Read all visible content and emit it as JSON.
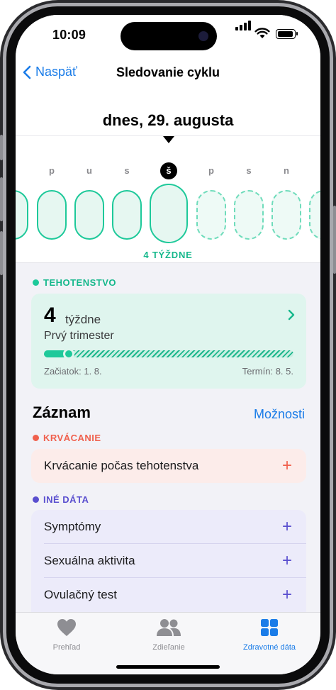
{
  "status_bar": {
    "time": "10:09"
  },
  "nav": {
    "back_label": "Naspäť",
    "title": "Sledovanie cyklu"
  },
  "calendar": {
    "date_title": "dnes, 29. augusta",
    "day_letters": [
      "p",
      "u",
      "s",
      "š",
      "p",
      "s",
      "n"
    ],
    "today_index": 3,
    "weeks_label": "4 TÝŽDNE"
  },
  "pregnancy": {
    "section_label": "TEHOTENSTVO",
    "weeks_number": "4",
    "weeks_unit": "týždne",
    "trimester": "Prvý trimester",
    "progress_fraction": 0.1,
    "start": "Začiatok: 1. 8.",
    "due": "Termín: 8. 5."
  },
  "log": {
    "title": "Záznam",
    "options_label": "Možnosti",
    "bleeding": {
      "section_label": "KRVÁCANIE",
      "row_label": "Krvácanie počas tehotenstva"
    },
    "other": {
      "section_label": "INÉ DÁTA",
      "rows": [
        "Symptómy",
        "Sexuálna aktivita",
        "Ovulačný test"
      ]
    }
  },
  "tabs": [
    {
      "label": "Prehľad",
      "icon": "heart-icon",
      "active": false
    },
    {
      "label": "Zdieľanie",
      "icon": "people-icon",
      "active": false
    },
    {
      "label": "Zdravotné dáta",
      "icon": "grid-icon",
      "active": true
    }
  ],
  "colors": {
    "accent_blue": "#1a7ce8",
    "mint": "#1ec99a",
    "bleeding": "#f0604d",
    "other": "#5a4fcf",
    "inactive_tab": "#8e8e93"
  }
}
